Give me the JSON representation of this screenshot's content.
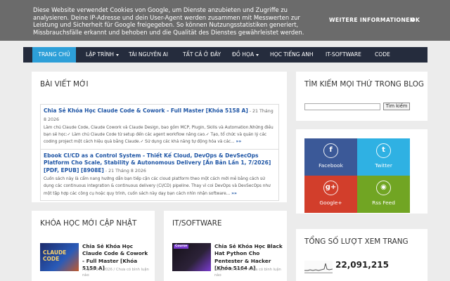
{
  "cookie": {
    "message": "Diese Website verwendet Cookies von Google, um Dienste anzubieten und Zugriffe zu analysieren. Deine IP-Adresse und dein User-Agent werden zusammen mit Messwerten zur Leistung und Sicherheit für Google freigegeben. So können Nutzungsstatistiken generiert, Missbrauchsfälle erkannt und behoben und die Qualität des Dienstes gewährleistet werden.",
    "more_label": "WEITERE INFORMATIONEN",
    "ok_label": "OK"
  },
  "nav": {
    "items": [
      {
        "label": "TRANG CHỦ"
      },
      {
        "label": "LẬP TRÌNH"
      },
      {
        "label": "TÀI NGUYÊN AI"
      },
      {
        "label": "TẤT CẢ Ở ĐÂY"
      },
      {
        "label": "ĐỒ HỌA"
      },
      {
        "label": "HỌC TIẾNG ANH"
      },
      {
        "label": "IT-SOFTWARE"
      },
      {
        "label": "CODE"
      }
    ]
  },
  "recent": {
    "title": "BÀI VIẾT MỚI",
    "posts": [
      {
        "title": "Chia Sẻ Khóa Học Claude Code & Cowork - Full Master [Khóa 5158 A]",
        "date": " - 21 Tháng 8 2026",
        "desc": "Làm chủ Claude Code, Claude Cowork và Claude Design, bao gồm MCP, Plugin, Skills và Automation.Những điều bạn sẽ học:✓ Làm chủ Claude Code từ setup đến các agent workflow nâng cao.✓ Tạo, tổ chức và quản lý các coding project một cách hiệu quả bằng Claude.✓ Sử dụng các khả năng tự động hóa và các...",
        "more": "»»"
      },
      {
        "title": "Ebook CI/CD as a Control System - Thiết Kế Cloud, DevOps & DevSecOps Platform Cho Scale, Stability & Autonomous Delivery [Ấn Bản Lần 1, 7/2026] [PDF, EPUB] [8908E]",
        "date": " - 21 Tháng 8 2026",
        "desc": "Cuốn sách này là cẩm nang hướng dẫn bạn tiếp cận các cloud platform theo một cách mới mẻ bằng cách sử dụng các continuous integration & continuous delivery (CI/CD) pipeline. Thay vì coi DevOps và DevSecOps như một tập hợp các công cụ hoặc quy trình, cuốn sách này dạy bạn cách nhìn nhận software...",
        "more": "»»"
      }
    ]
  },
  "search": {
    "title": "TÌM KIẾM MỌI THỨ TRONG BLOG",
    "placeholder": "",
    "button_label": "Tìm kiếm"
  },
  "social": {
    "items": [
      {
        "label": "Facebook",
        "glyph": "f",
        "color": "#3b5998"
      },
      {
        "label": "Twitter",
        "glyph": "t",
        "color": "#2fb1e3"
      },
      {
        "label": "Google+",
        "glyph": "g+",
        "color": "#d23e2b"
      },
      {
        "label": "Rss Feed",
        "glyph": "◉",
        "color": "#71a523"
      }
    ]
  },
  "courses": {
    "title": "KHÓA HỌC MỚI CẬP NHẬT",
    "item": {
      "title": "Chia Sẻ Khóa Học Claude Code & Cowork - Full Master [Khóa 5158 A]",
      "meta": "August 21, 2026 / Chưa có bình luận nào",
      "thumb_text": "CLAUDE CODE"
    }
  },
  "software": {
    "title": "IT/SOFTWARE",
    "item": {
      "title": "Chia Sẻ Khóa Học Black Hat Python Cho Pentester & Hacker [Khóa 5164 A]",
      "meta": "August 18, 2026 / Chưa có bình luận nào",
      "thumb_badge": "Course"
    }
  },
  "counter": {
    "title": "TỔNG SỐ LƯỢT XEM TRANG",
    "value": "22,091,215"
  },
  "colors": {
    "nav_bg": "#252c3d",
    "nav_active": "#2d9fd8",
    "link": "#1e55a5",
    "cookie_bg": "#6b6b6b"
  }
}
